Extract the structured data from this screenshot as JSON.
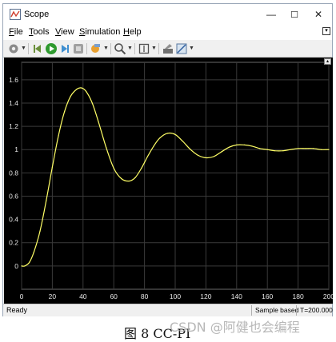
{
  "window": {
    "title": "Scope",
    "controls": {
      "minimize": "—",
      "maximize": "☐",
      "close": "✕"
    }
  },
  "menu": [
    {
      "label": "File",
      "mnemonic": "F",
      "rest": "ile"
    },
    {
      "label": "Tools",
      "mnemonic": "T",
      "rest": "ools"
    },
    {
      "label": "View",
      "mnemonic": "V",
      "rest": "iew"
    },
    {
      "label": "Simulation",
      "mnemonic": "S",
      "rest": "imulation"
    },
    {
      "label": "Help",
      "mnemonic": "H",
      "rest": "elp"
    }
  ],
  "toolbar": {
    "icons": [
      "settings-icon",
      "step-back-icon",
      "run-icon",
      "step-forward-icon",
      "stop-icon",
      "highlight-icon",
      "zoom-icon",
      "fit-to-view-icon",
      "write-icon",
      "style-icon"
    ]
  },
  "status": {
    "left": "Ready",
    "mode": "Sample based",
    "time": "T=200.000"
  },
  "caption": "图 8 CC-PI",
  "watermark": "CSDN @阿健也会编程",
  "colors": {
    "plot_bg": "#000000",
    "trace": "#ffff66",
    "grid": "#3a3a3a",
    "axis_text": "#e6e6e6"
  },
  "chart_data": {
    "type": "line",
    "title": "",
    "xlabel": "",
    "ylabel": "",
    "xlim": [
      0,
      200
    ],
    "ylim": [
      -0.2,
      1.75
    ],
    "xticks": [
      0,
      20,
      40,
      60,
      80,
      100,
      120,
      140,
      160,
      180,
      200
    ],
    "yticks": [
      0,
      0.2,
      0.4,
      0.6,
      0.8,
      1,
      1.2,
      1.4,
      1.6
    ],
    "grid": true,
    "series": [
      {
        "color": "#ffff66",
        "x": [
          0,
          2,
          5,
          8,
          12,
          16,
          20,
          24,
          28,
          32,
          36,
          39,
          42,
          46,
          50,
          55,
          60,
          65,
          70,
          74,
          78,
          82,
          86,
          90,
          95,
          100,
          105,
          110,
          115,
          120,
          125,
          130,
          135,
          140,
          145,
          150,
          155,
          160,
          165,
          170,
          175,
          180,
          185,
          190,
          195,
          200
        ],
        "y": [
          0,
          0.0,
          0.03,
          0.12,
          0.3,
          0.56,
          0.85,
          1.12,
          1.33,
          1.46,
          1.52,
          1.53,
          1.5,
          1.4,
          1.24,
          1.02,
          0.84,
          0.75,
          0.73,
          0.76,
          0.84,
          0.94,
          1.03,
          1.1,
          1.14,
          1.13,
          1.07,
          1.0,
          0.95,
          0.93,
          0.94,
          0.98,
          1.02,
          1.04,
          1.04,
          1.03,
          1.01,
          1.0,
          0.99,
          0.99,
          1.0,
          1.01,
          1.01,
          1.01,
          1.0,
          1.0
        ]
      }
    ]
  }
}
